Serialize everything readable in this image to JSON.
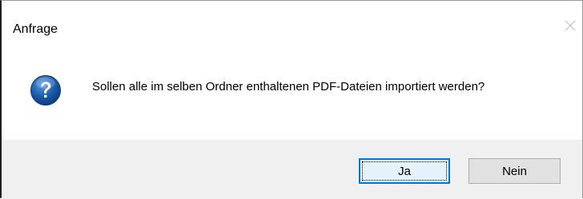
{
  "window": {
    "title": "Anfrage",
    "close_icon": "close-icon"
  },
  "dialog": {
    "icon": "question-icon",
    "message": "Sollen alle im selben Ordner enthaltenen PDF-Dateien importiert werden?"
  },
  "buttons": {
    "yes_label": "Ja",
    "no_label": "Nein"
  },
  "colors": {
    "icon_blue": "#1c5aa8",
    "focus_border": "#0078d7",
    "footer_bg": "#f0f0f0"
  }
}
